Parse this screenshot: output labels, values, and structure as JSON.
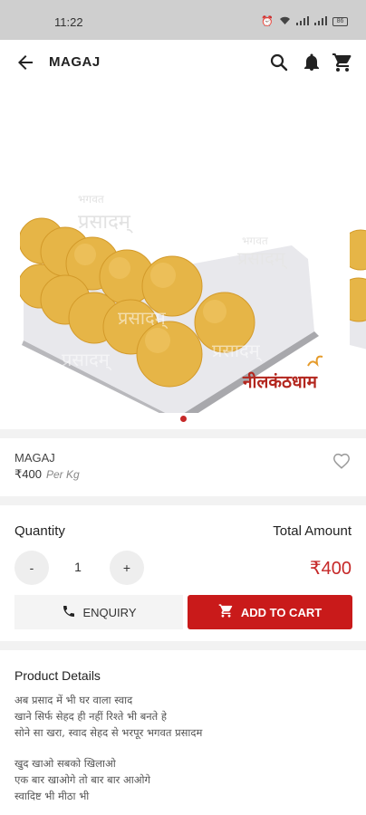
{
  "status_bar": {
    "time": "11:22",
    "battery": "86"
  },
  "header": {
    "title": "MAGAJ"
  },
  "carousel": {
    "watermark_top": "भगवत",
    "watermark_main": "प्रसादम्",
    "brand_logo": "नीलकंठधाम"
  },
  "product": {
    "name": "MAGAJ",
    "price": "₹400",
    "unit": "Per Kg"
  },
  "purchase": {
    "quantity_label": "Quantity",
    "total_label": "Total Amount",
    "decrement": "-",
    "increment": "+",
    "quantity": "1",
    "total": "₹400",
    "enquiry_label": "ENQUIRY",
    "add_to_cart_label": "ADD TO CART"
  },
  "details": {
    "title": "Product Details",
    "lines": [
      "अब प्रसाद में भी घर वाला स्वाद",
      "खाने सिर्फ सेहद ही नहीं रिश्ते भी बनते हे",
      "सोने सा खरा, स्वाद सेहद से भरपूर भगवत प्रसादम",
      "खुद खाओ सबको खिलाओ",
      "एक बार खाओगे तो बार बार आओगे",
      "स्वादिष्ट भी मीठा भी"
    ]
  },
  "colors": {
    "accent": "#c91a1a",
    "price": "#c62828",
    "laddu": "#e8b84a"
  }
}
